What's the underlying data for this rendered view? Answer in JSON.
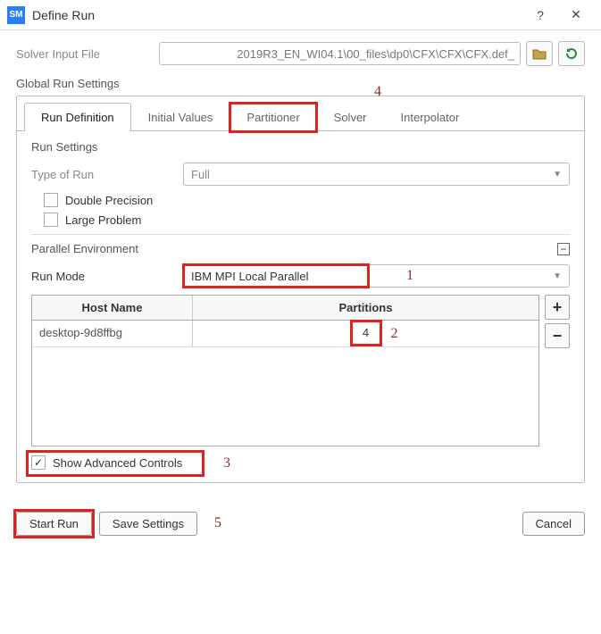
{
  "window": {
    "title": "Define Run"
  },
  "solver": {
    "label": "Solver Input File",
    "path": "_2019R3_EN_WI04.1\\00_files\\dp0\\CFX\\CFX\\CFX.def"
  },
  "global": {
    "title": "Global Run Settings"
  },
  "tabs": {
    "items": [
      {
        "label": "Run Definition"
      },
      {
        "label": "Initial Values"
      },
      {
        "label": "Partitioner"
      },
      {
        "label": "Solver"
      },
      {
        "label": "Interpolator"
      }
    ]
  },
  "runSettings": {
    "title": "Run Settings",
    "typeLabel": "Type of Run",
    "typeValue": "Full",
    "doublePrecision": "Double Precision",
    "largeProblem": "Large Problem"
  },
  "parallel": {
    "title": "Parallel Environment",
    "runModeLabel": "Run Mode",
    "runModeValue": "IBM MPI Local Parallel",
    "headers": {
      "host": "Host Name",
      "partitions": "Partitions"
    },
    "rows": [
      {
        "host": "desktop-9d8ffbg",
        "partitions": "4"
      }
    ],
    "showAdvanced": "Show Advanced Controls",
    "showAdvancedChecked": true
  },
  "buttons": {
    "startRun": "Start Run",
    "saveSettings": "Save Settings",
    "cancel": "Cancel"
  },
  "annotations": {
    "n1": "1",
    "n2": "2",
    "n3": "3",
    "n4": "4",
    "n5": "5"
  }
}
